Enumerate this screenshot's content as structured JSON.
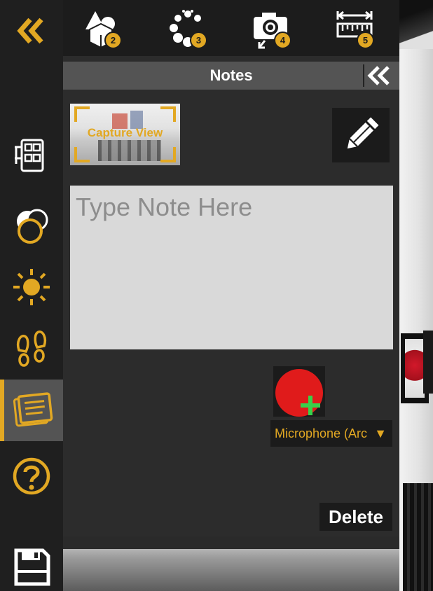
{
  "top_toolbar": {
    "collapse_icon": "double-chevron-left-icon",
    "tools": [
      {
        "icon": "shapes-icon",
        "badge": "2"
      },
      {
        "icon": "dots-circle-icon",
        "badge": "3"
      },
      {
        "icon": "camera-icon",
        "badge": "4"
      },
      {
        "icon": "ruler-icon",
        "badge": "5"
      }
    ]
  },
  "sidebar": {
    "items": [
      {
        "icon": "layout-tree-icon"
      },
      {
        "icon": "material-toggle-icon"
      },
      {
        "icon": "sun-icon"
      },
      {
        "icon": "footsteps-icon"
      },
      {
        "icon": "notes-icon",
        "active": true
      },
      {
        "icon": "help-icon"
      },
      {
        "icon": "save-icon"
      }
    ]
  },
  "notes_panel": {
    "title": "Notes",
    "capture_label": "Capture View",
    "note_placeholder": "Type Note Here",
    "note_value": "",
    "microphone_select": "Microphone (Arc",
    "delete_label": "Delete"
  },
  "colors": {
    "accent": "#e2a823",
    "panel_bg": "#2c2c2c",
    "header_bg": "#545454",
    "record_red": "#e01b1b",
    "add_green": "#37d14a"
  }
}
